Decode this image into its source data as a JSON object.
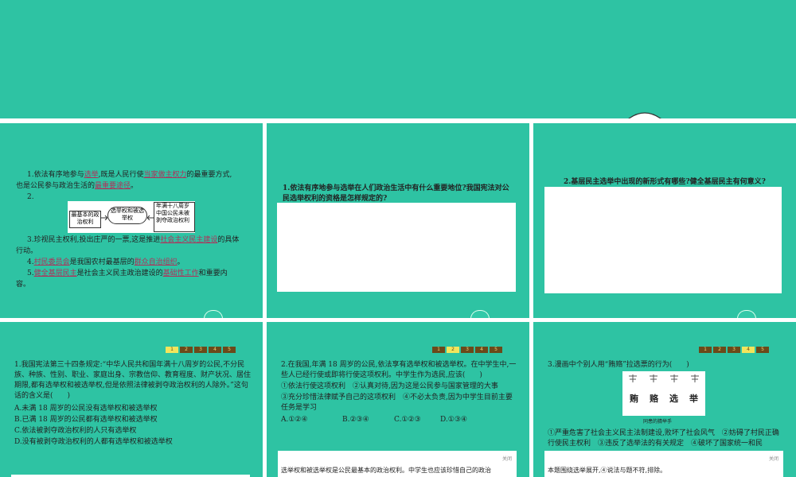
{
  "p1": {
    "l1a": "1.依法有序地参与",
    "l1u1": "选举",
    "l1b": ",既是人民行使",
    "l1u2": "当家做主权力",
    "l1c": "的最重要方式,",
    "l2a": "也是公民参与政治生活的",
    "l2u": "最重要途径",
    "l2b": "。",
    "item2": "2.",
    "diagram": {
      "left": "最基本的政治权利",
      "mid": "选举权和被选举权",
      "right": "年满十八周岁中国公民未被剥夺政治权利"
    },
    "l3a": "3.珍视民主权利,投出庄严的一票,这是推进",
    "l3u": "社会主义民主建设",
    "l3b": "的具体",
    "l3c": "行动。",
    "l4a": "4.",
    "l4u1": "村民委员会",
    "l4b": "是我国农村最基层的",
    "l4u2": "群众自治组织",
    "l4c": "。",
    "l5a": "5.",
    "l5u1": "健全基层民主",
    "l5b": "是社会主义民主政治建设的",
    "l5u2": "基础性工作",
    "l5c": "和重要内",
    "l5d": "容。"
  },
  "p2": {
    "q": "1.依法有序地参与选举在人们政治生活中有什么重要地位?我国宪法对公民选举权利的资格是怎样规定的?"
  },
  "p3": {
    "q": "2.基层民主选举中出现的新形式有哪些?健全基层民主有何意义?"
  },
  "pager": [
    "1",
    "2",
    "3",
    "4",
    "5"
  ],
  "p4": {
    "q": "1.我国宪法第三十四条规定:“中华人民共和国年满十八周岁的公民,不分民族、种族、性别、职业、家庭出身、宗教信仰、教育程度、财产状况、居住期限,都有选举权和被选举权,但是依照法律被剥夺政治权利的人除外。”这句话的含义是(　　)",
    "a": "A.未满 18 周岁的公民没有选举权和被选举权",
    "b": "B.已满 18 周岁的公民都有选举权和被选举权",
    "c": "C.依法被剥夺政治权利的人只有选举权",
    "d": "D.没有被剥夺政治权利的人都有选举权和被选举权"
  },
  "p5": {
    "q": "2.在我国,年满 18 周岁的公民,依法享有选举权和被选举权。在中学生中,一些人已经行使或即将行使这项权利。中学生作为选民,应该(　　)",
    "o1": "①依法行使这项权利　②认真对待,因为这是公民参与国家管理的大事",
    "o2": "③充分珍惜法律赋予自己的这项权利　④不必太负责,因为中学生目前主要任务是学习",
    "choices": [
      "A.①②④",
      "B.②③④",
      "C.①②③",
      "D.①③④"
    ],
    "close": "关闭",
    "answer": "选举权和被选举权是公民最基本的政治权利。中学生也应该珍惜自己的政治"
  },
  "p6": {
    "q": "3.漫画中个别人用“贿赂”拉选票的行为(　　)",
    "chars": [
      "贿",
      "赂",
      "选",
      "举"
    ],
    "caption": "同患的猜举手",
    "o1": "①严重危害了社会主义民主法制建设,败坏了社会风气　②妨碍了村民正确行使民主权利　③违反了选举法的有关规定　④破坏了国家统一和民",
    "close": "关闭",
    "answer": "本题围绕选举展开,④说法与题不符,排除。"
  }
}
